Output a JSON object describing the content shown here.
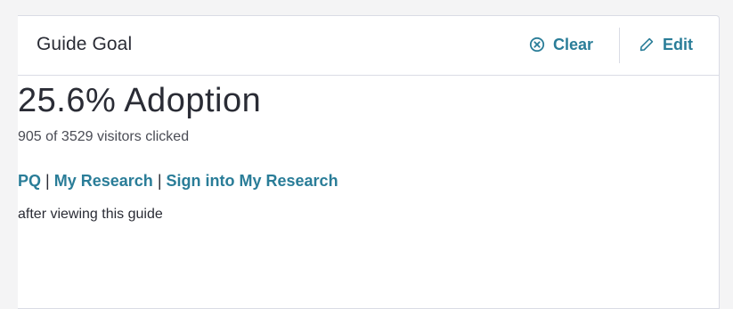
{
  "card": {
    "title": "Guide Goal",
    "clear_label": "Clear",
    "edit_label": "Edit",
    "clear_icon": "circle-x-icon",
    "edit_icon": "pencil-icon"
  },
  "goal": {
    "adoption_text": "25.6% Adoption",
    "visitors_text": "905 of 3529 visitors clicked",
    "target_parts": [
      "PQ",
      "My Research",
      "Sign into My Research"
    ],
    "separator": "|",
    "after_text": "after viewing this guide"
  },
  "colors": {
    "accent": "#2a7d98",
    "text": "#2a2c35",
    "border": "#dadce5",
    "background": "#f4f4f5"
  }
}
